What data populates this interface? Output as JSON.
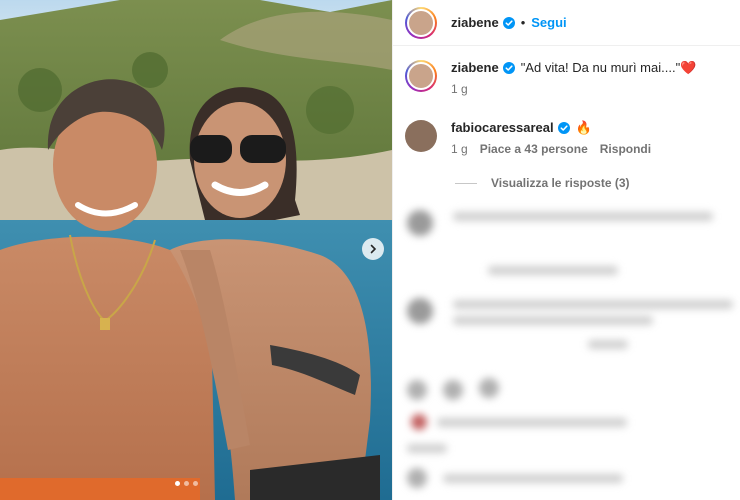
{
  "post": {
    "author": "ziabene",
    "follow_label": "Segui",
    "separator": "•",
    "carousel": {
      "total": 3,
      "active": 1
    }
  },
  "comments": [
    {
      "username": "ziabene",
      "verified": true,
      "text": "\"Ad vita! Da nu murì mai....\"❤️",
      "time": "1 g"
    },
    {
      "username": "fabiocaressareal",
      "verified": true,
      "text": "🔥",
      "time": "1 g",
      "likes_label": "Piace a 43 persone",
      "reply_label": "Rispondi",
      "view_replies_label": "Visualizza le risposte (3)"
    }
  ],
  "colors": {
    "accent": "#0095f6",
    "verified": "#0095f6",
    "text": "#262626",
    "muted": "#737373"
  },
  "icons": [
    "verified-badge-icon",
    "chevron-right-icon",
    "heart-icon",
    "comment-icon",
    "share-icon",
    "smiley-icon"
  ]
}
